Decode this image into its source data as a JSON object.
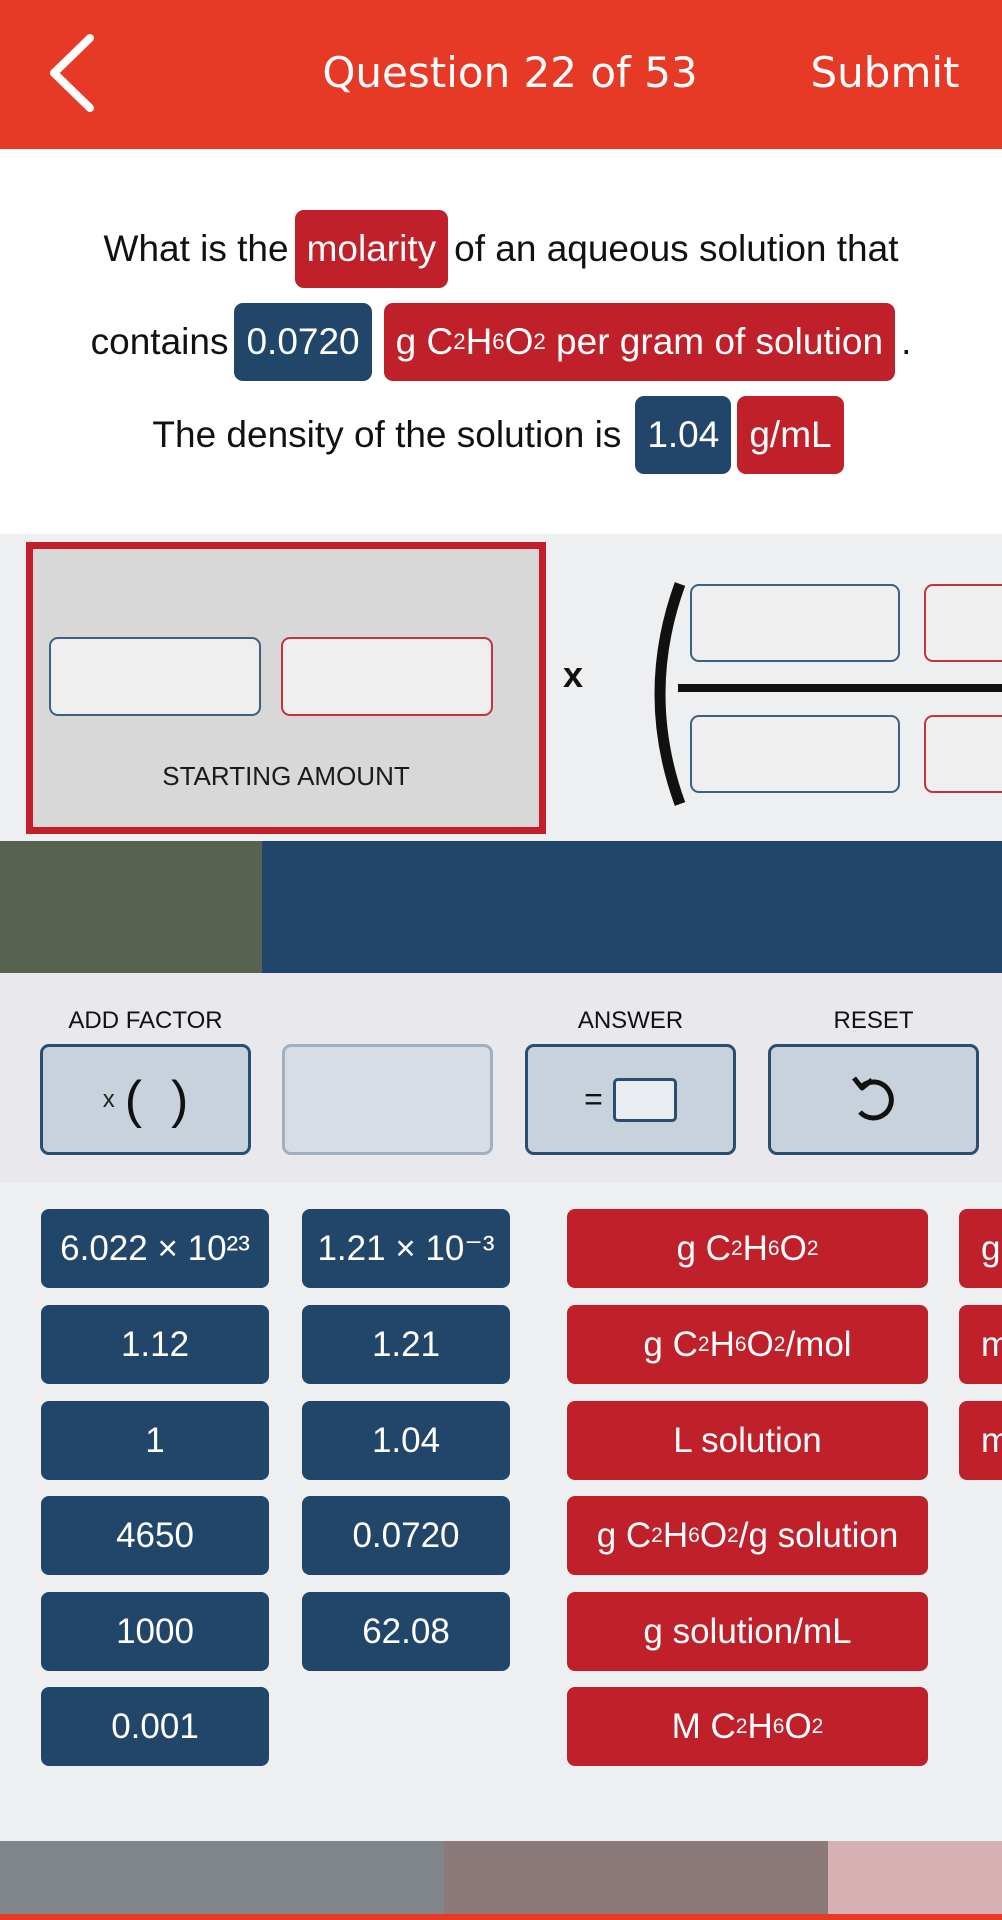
{
  "header": {
    "title": "Question 22 of 53",
    "submit_label": "Submit",
    "bg_color": "#e63a26"
  },
  "question": {
    "line1_prefix": "What is the",
    "line1_chip": "molarity",
    "line1_suffix": "of an aqueous solution that",
    "line2_prefix": "contains",
    "line2_value": "0.0720",
    "line2_unit_pre": "g C",
    "line2_unit_sub1": "2",
    "line2_unit_mid1": "H",
    "line2_unit_sub2": "6",
    "line2_unit_mid2": "O",
    "line2_unit_sub3": "2",
    "line2_unit_post": " per gram of solution",
    "line2_end": ".",
    "line3_prefix": "The density of the solution is",
    "line3_value": "1.04",
    "line3_unit": "g/mL"
  },
  "workspace": {
    "starting_amount_label": "STARTING AMOUNT",
    "times_symbol": "x"
  },
  "factor_controls": {
    "add_factor_label": "ADD FACTOR",
    "add_factor_x": "x",
    "add_factor_parens": "(  )",
    "answer_label": "ANSWER",
    "answer_eq": "=",
    "reset_label": "RESET"
  },
  "number_tiles": {
    "col1": [
      "6.022 × 10²³",
      "1.12",
      "1",
      "4650",
      "1000",
      "0.001"
    ],
    "col2": [
      "1.21 × 10⁻³",
      "1.21",
      "1.04",
      "0.0720",
      "62.08"
    ]
  },
  "unit_tiles": {
    "col3": [
      {
        "pre": "g C",
        "s1": "2",
        "m1": "H",
        "s2": "6",
        "m2": "O",
        "s3": "2",
        "post": ""
      },
      {
        "pre": "g C",
        "s1": "2",
        "m1": "H",
        "s2": "6",
        "m2": "O",
        "s3": "2",
        "post": "/mol"
      },
      {
        "pre": "L solution",
        "s1": "",
        "m1": "",
        "s2": "",
        "m2": "",
        "s3": "",
        "post": ""
      },
      {
        "pre": "g C",
        "s1": "2",
        "m1": "H",
        "s2": "6",
        "m2": "O",
        "s3": "2",
        "post": "/g solution"
      },
      {
        "pre": "g solution/mL",
        "s1": "",
        "m1": "",
        "s2": "",
        "m2": "",
        "s3": "",
        "post": ""
      },
      {
        "pre": "M C",
        "s1": "2",
        "m1": "H",
        "s2": "6",
        "m2": "O",
        "s3": "2",
        "post": ""
      }
    ],
    "col4_partial": [
      "g",
      "m",
      "m"
    ]
  },
  "colors": {
    "accent_red": "#bf2029",
    "accent_blue": "#22466a",
    "band_green": "#576350",
    "band_blue": "#22466a",
    "bottom_1": "#80868a",
    "bottom_2": "#8c7a7b",
    "bottom_3": "#d6b1b3"
  }
}
